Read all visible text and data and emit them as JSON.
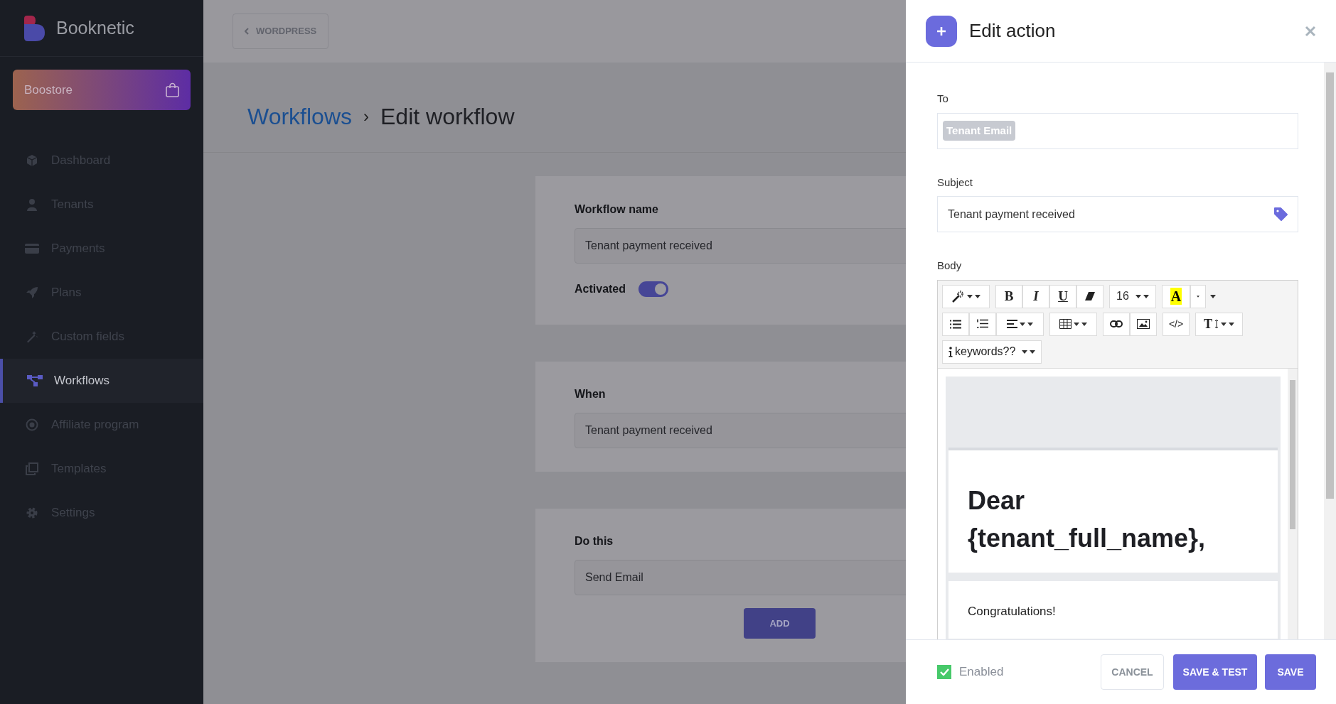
{
  "brand": {
    "name": "Booknetic"
  },
  "store_button": {
    "label": "Boostore"
  },
  "sidebar": {
    "items": [
      {
        "label": "Dashboard",
        "selected": false
      },
      {
        "label": "Tenants",
        "selected": false
      },
      {
        "label": "Payments",
        "selected": false
      },
      {
        "label": "Plans",
        "selected": false
      },
      {
        "label": "Custom fields",
        "selected": false
      },
      {
        "label": "Workflows",
        "selected": true
      },
      {
        "label": "Affiliate program",
        "selected": false
      },
      {
        "label": "Templates",
        "selected": false
      },
      {
        "label": "Settings",
        "selected": false
      }
    ]
  },
  "top_bar": {
    "back_button": "WORDPRESS"
  },
  "breadcrumb": {
    "parent": "Workflows",
    "separator": "›",
    "current": "Edit workflow"
  },
  "workflow_card": {
    "name_label": "Workflow name",
    "name_value": "Tenant payment received",
    "activated_label": "Activated",
    "activated_on": true
  },
  "when_card": {
    "label": "When",
    "value": "Tenant payment received"
  },
  "do_card": {
    "label": "Do this",
    "value": "Send Email",
    "add_button": "ADD"
  },
  "panel": {
    "title": "Edit action",
    "to": {
      "label": "To",
      "tags": [
        "Tenant Email"
      ]
    },
    "subject": {
      "label": "Subject",
      "value": "Tenant payment received"
    },
    "body": {
      "label": "Body",
      "toolbar": {
        "bold": "B",
        "italic": "I",
        "underline": "U",
        "font_size": "16",
        "highlight": "A",
        "code_view": "</>",
        "text_height": "T",
        "keywords": "keywords??"
      },
      "heading": "Dear {tenant_full_name},",
      "paragraph": "Congratulations!"
    },
    "enabled": {
      "label": "Enabled",
      "checked": true
    },
    "buttons": {
      "cancel": "CANCEL",
      "save_test": "SAVE & TEST",
      "save": "SAVE"
    }
  }
}
